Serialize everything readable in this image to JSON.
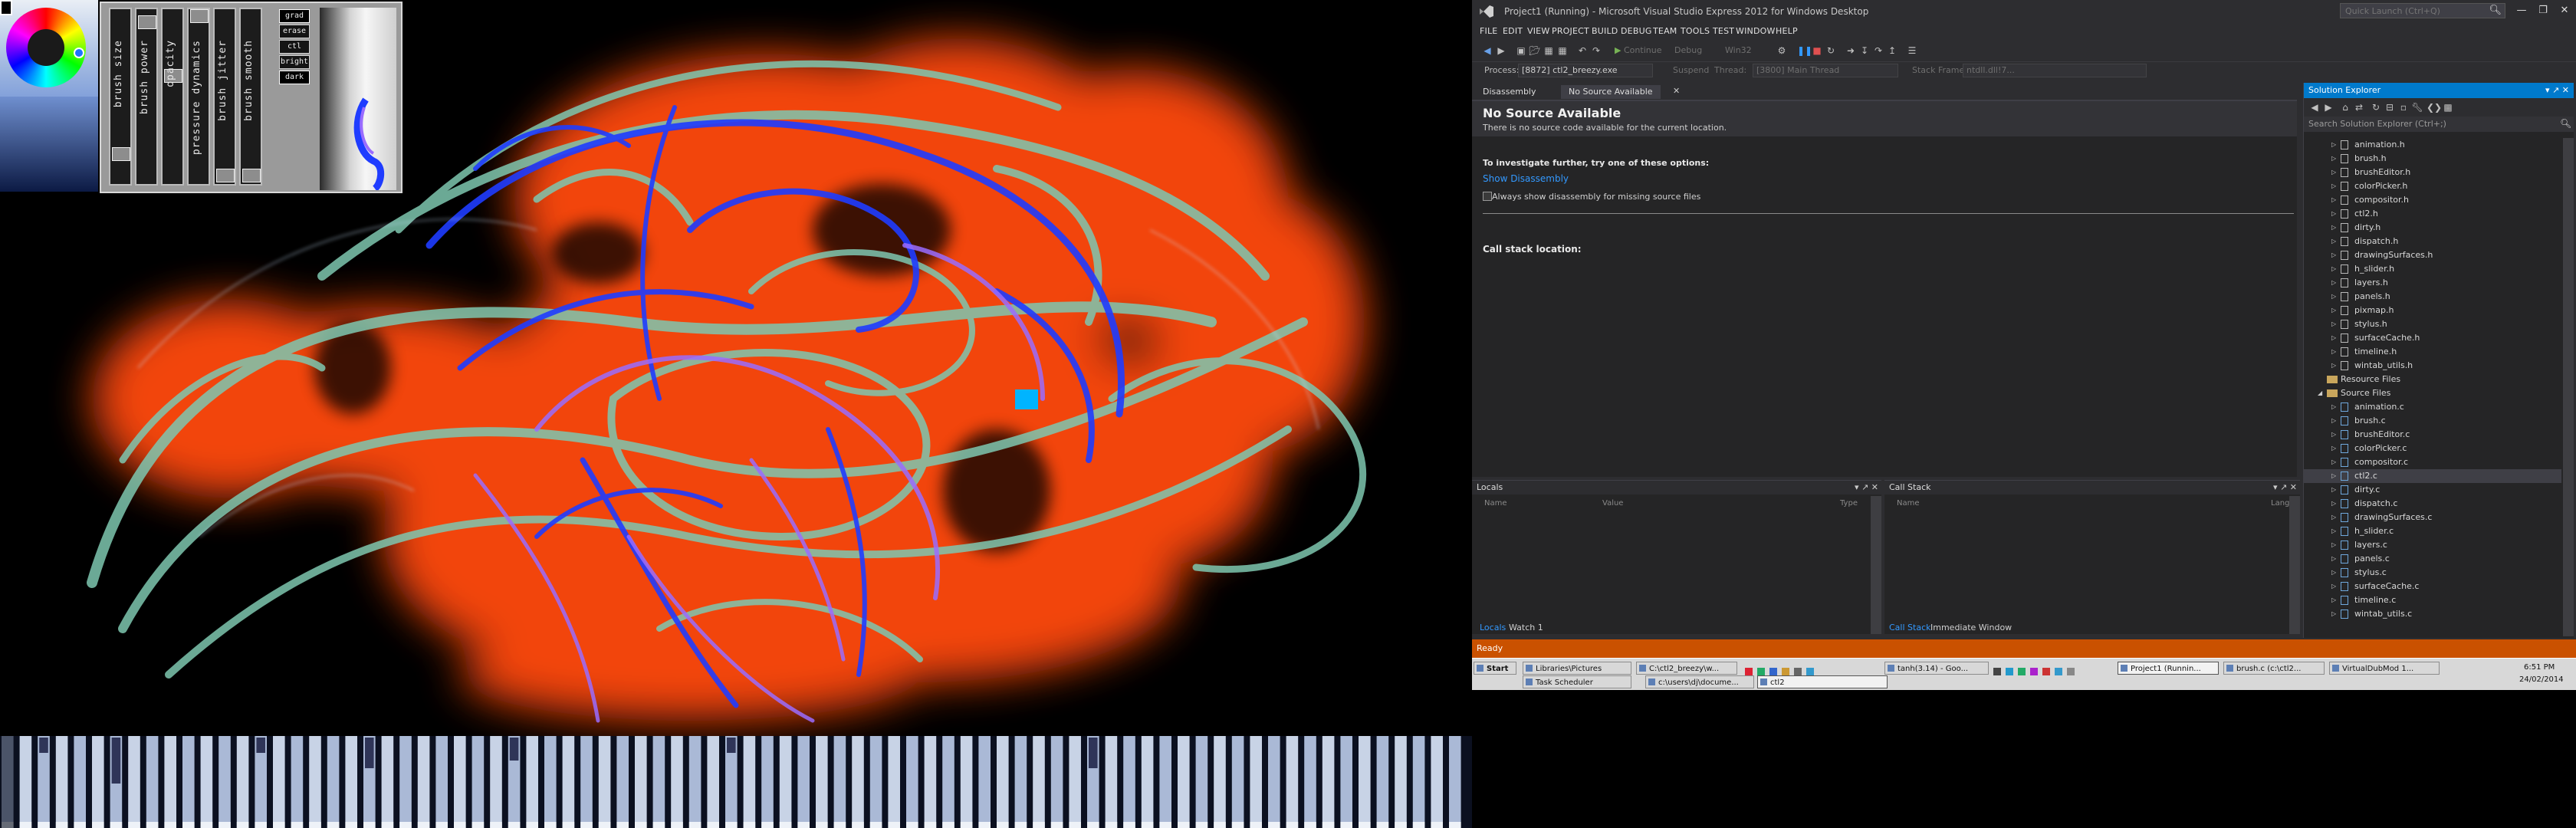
{
  "paint_app": {
    "sliders": [
      {
        "label": "brush size"
      },
      {
        "label": "brush power"
      },
      {
        "label": "opacity"
      },
      {
        "label": "pressure dynamics"
      },
      {
        "label": "brush jitter"
      },
      {
        "label": "brush smooth"
      }
    ],
    "mode_buttons": [
      "grad",
      "erase",
      "ctl",
      "bright",
      "dark"
    ],
    "accent_colors": {
      "orange": "#ff4a10",
      "teal": "#7ec7b0",
      "blue": "#1f3cff",
      "purple": "#9a6cff"
    }
  },
  "vs": {
    "title": "Project1 (Running) - Microsoft Visual Studio Express 2012 for Windows Desktop",
    "quick_launch_placeholder": "Quick Launch (Ctrl+Q)",
    "window_buttons": [
      "—",
      "❐",
      "✕"
    ],
    "menu": [
      "FILE",
      "EDIT",
      "VIEW",
      "PROJECT",
      "BUILD",
      "DEBUG",
      "TEAM",
      "TOOLS",
      "TEST",
      "WINDOW",
      "HELP"
    ],
    "toolbar": {
      "continue_label": "Continue",
      "config": "Debug",
      "platform": "Win32"
    },
    "debugbar": {
      "process_label": "Process:",
      "process_value": "[8872] ctl2_breezy.exe",
      "suspend_label": "Suspend",
      "thread_label": "Thread:",
      "thread_value": "[3800] Main Thread",
      "stack_label": "Stack Frame:",
      "stack_value": "ntdll.dll!7..."
    },
    "doc_tabs": [
      "Disassembly",
      "No Source Available"
    ],
    "no_source": {
      "title": "No Source Available",
      "desc": "There is no source code available for the current location.",
      "investigate": "To investigate further, try one of these options:",
      "show_disasm": "Show Disassembly",
      "always_show": "Always show disassembly for missing source files",
      "call_stack_location": "Call stack location:"
    },
    "locals": {
      "title": "Locals",
      "columns": [
        "Name",
        "Value",
        "Type"
      ],
      "tabs": [
        "Locals",
        "Watch 1"
      ]
    },
    "callstack": {
      "title": "Call Stack",
      "columns": [
        "Name",
        "Lang"
      ],
      "tabs": [
        "Call Stack",
        "Immediate Window"
      ]
    },
    "solution_explorer": {
      "title": "Solution Explorer",
      "search_placeholder": "Search Solution Explorer (Ctrl+;)",
      "items": [
        {
          "label": "animation.h",
          "kind": "h"
        },
        {
          "label": "brush.h",
          "kind": "h"
        },
        {
          "label": "brushEditor.h",
          "kind": "h"
        },
        {
          "label": "colorPicker.h",
          "kind": "h"
        },
        {
          "label": "compositor.h",
          "kind": "h"
        },
        {
          "label": "ctl2.h",
          "kind": "h"
        },
        {
          "label": "dirty.h",
          "kind": "h"
        },
        {
          "label": "dispatch.h",
          "kind": "h"
        },
        {
          "label": "drawingSurfaces.h",
          "kind": "h"
        },
        {
          "label": "h_slider.h",
          "kind": "h"
        },
        {
          "label": "layers.h",
          "kind": "h"
        },
        {
          "label": "panels.h",
          "kind": "h"
        },
        {
          "label": "pixmap.h",
          "kind": "h"
        },
        {
          "label": "stylus.h",
          "kind": "h"
        },
        {
          "label": "surfaceCache.h",
          "kind": "h"
        },
        {
          "label": "timeline.h",
          "kind": "h"
        },
        {
          "label": "wintab_utils.h",
          "kind": "h"
        },
        {
          "label": "Resource Files",
          "kind": "folder"
        },
        {
          "label": "Source Files",
          "kind": "folder-open"
        },
        {
          "label": "animation.c",
          "kind": "c"
        },
        {
          "label": "brush.c",
          "kind": "c"
        },
        {
          "label": "brushEditor.c",
          "kind": "c"
        },
        {
          "label": "colorPicker.c",
          "kind": "c"
        },
        {
          "label": "compositor.c",
          "kind": "c"
        },
        {
          "label": "ctl2.c",
          "kind": "c"
        },
        {
          "label": "dirty.c",
          "kind": "c"
        },
        {
          "label": "dispatch.c",
          "kind": "c"
        },
        {
          "label": "drawingSurfaces.c",
          "kind": "c"
        },
        {
          "label": "h_slider.c",
          "kind": "c"
        },
        {
          "label": "layers.c",
          "kind": "c"
        },
        {
          "label": "panels.c",
          "kind": "c"
        },
        {
          "label": "stylus.c",
          "kind": "c"
        },
        {
          "label": "surfaceCache.c",
          "kind": "c"
        },
        {
          "label": "timeline.c",
          "kind": "c"
        },
        {
          "label": "wintab_utils.c",
          "kind": "c"
        }
      ]
    },
    "status": "Ready"
  },
  "taskbar": {
    "start_label": "Start",
    "tasks_row1": [
      "Libraries\\Pictures",
      "C:\\ctl2_breezy\\w...",
      "tanh(3.14) - Goo...",
      "Project1 (Runnin...",
      "brush.c (c:\\ctl2...",
      "VirtualDubMod 1..."
    ],
    "tasks_row2": [
      "Task Scheduler",
      "c:\\users\\dj\\docume...",
      "ctl2"
    ],
    "clock_time": "6:51 PM",
    "clock_date": "24/02/2014"
  }
}
